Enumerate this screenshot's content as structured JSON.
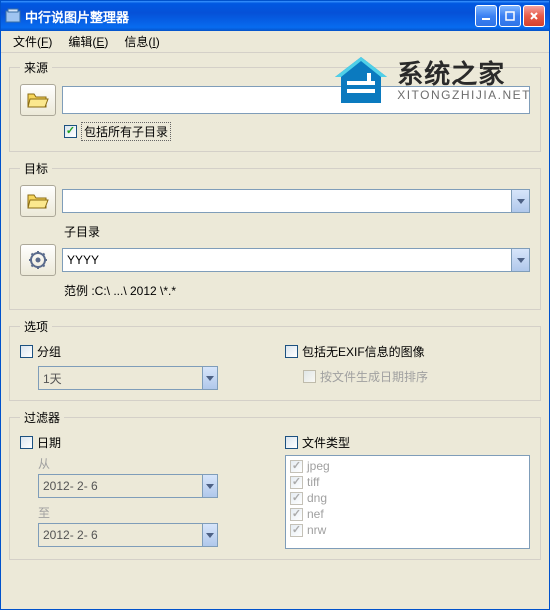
{
  "titlebar": {
    "title": "中行说图片整理器"
  },
  "menubar": {
    "file": "文件(F)",
    "edit": "编辑(E)",
    "info": "信息(I)"
  },
  "watermark": {
    "main": "系统之家",
    "sub": "XITONGZHIJIA.NET"
  },
  "source": {
    "legend": "来源",
    "path": "",
    "include_subdirs_label": "包括所有子目录",
    "include_subdirs_checked": true
  },
  "target": {
    "legend": "目标",
    "path": "",
    "subdir_label": "子目录",
    "subdir_value": "YYYY",
    "example_label": "范例 :C:\\ ...\\ 2012 \\*.*"
  },
  "options": {
    "legend": "选项",
    "group_label": "分组",
    "group_checked": false,
    "group_value": "1天",
    "include_noexif_label": "包括无EXIF信息的图像",
    "include_noexif_checked": false,
    "sort_by_date_label": "按文件生成日期排序",
    "sort_by_date_checked": false
  },
  "filter": {
    "legend": "过滤器",
    "date_label": "日期",
    "date_checked": false,
    "from_label": "从",
    "from_value": "2012- 2- 6",
    "to_label": "至",
    "to_value": "2012- 2- 6",
    "filetype_label": "文件类型",
    "filetype_checked": false,
    "types": [
      {
        "name": "jpeg",
        "checked": true
      },
      {
        "name": "tiff",
        "checked": true
      },
      {
        "name": "dng",
        "checked": true
      },
      {
        "name": "nef",
        "checked": true
      },
      {
        "name": "nrw",
        "checked": true
      }
    ]
  }
}
